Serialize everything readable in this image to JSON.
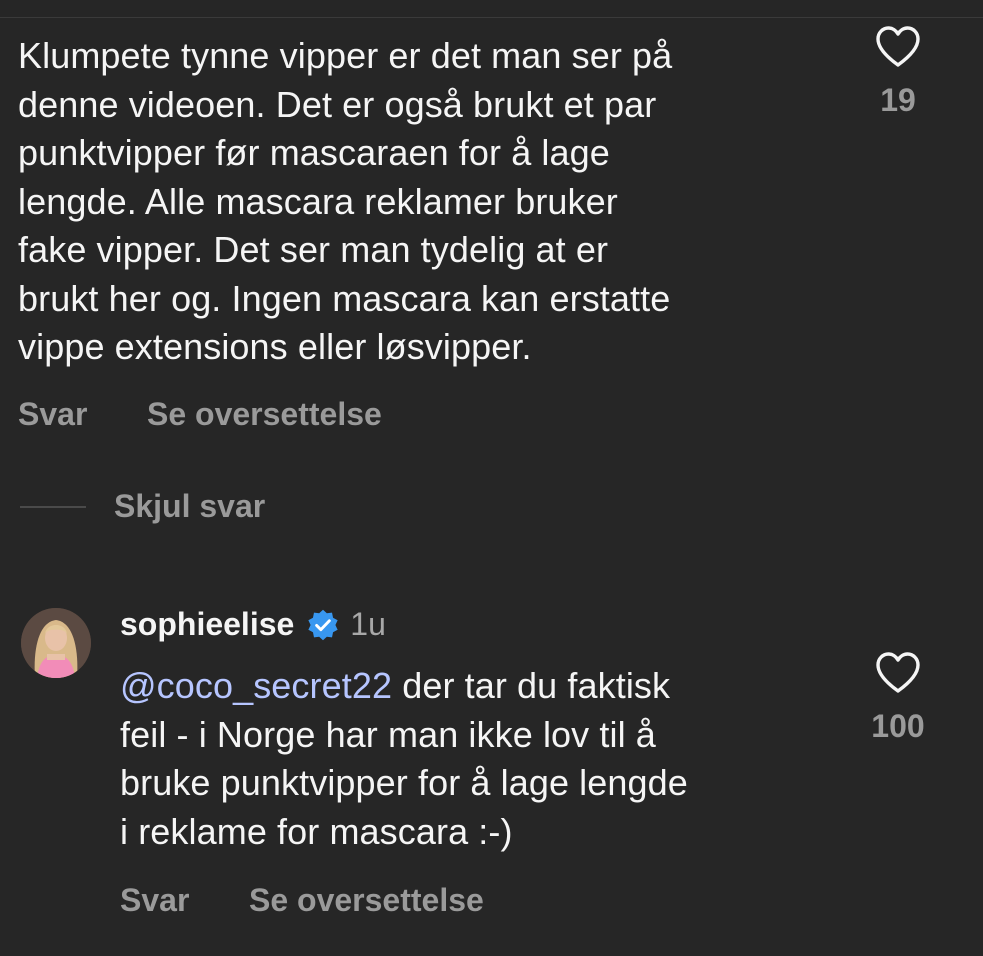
{
  "comment1": {
    "text": "Klumpete tynne vipper er det man ser på\ndenne videoen. Det er også brukt et par\npunktvipper før mascaraen for å lage\nlengde. Alle mascara reklamer bruker\nfake vipper. Det ser man tydelig at er\nbrukt her og. Ingen mascara kan erstatte\nvippe extensions eller løsvipper.",
    "like_count": "19",
    "reply_label": "Svar",
    "translate_label": "Se oversettelse"
  },
  "replies_toggle": {
    "label": "Skjul svar"
  },
  "comment2": {
    "username": "sophieelise",
    "timestamp": "1u",
    "mention": "@coco_secret22",
    "text": " der tar du faktisk\nfeil - i Norge har man ikke lov til å\nbruke punktvipper for å lage lengde\ni reklame for mascara :-)",
    "like_count": "100",
    "reply_label": "Svar",
    "translate_label": "Se oversettelse",
    "verified_icon": "verified-badge-icon",
    "verified_color": "#3897f0"
  },
  "colors": {
    "background": "#262626",
    "primary_text": "#f5f5f5",
    "secondary_text": "#9a9a9a",
    "mention": "#b6c5ff"
  },
  "icons": {
    "like": "heart-outline-icon"
  }
}
